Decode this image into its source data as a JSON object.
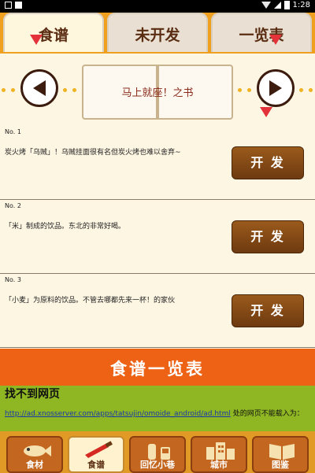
{
  "status_bar": {
    "time": "1:28"
  },
  "tabs": [
    {
      "label": "食谱",
      "active": true
    },
    {
      "label": "未开发",
      "active": false
    },
    {
      "label": "一览表",
      "active": false
    }
  ],
  "book": {
    "title": "马上就座！之书"
  },
  "recipes": [
    {
      "num": "No. 1",
      "desc": "炭火烤「乌贼」！乌贼挂面很有名但炭火烤也难以舍弃~",
      "button": "开 发"
    },
    {
      "num": "No. 2",
      "desc": "「米」制成的饮品。东北的非常好喝。",
      "button": "开 发"
    },
    {
      "num": "No. 3",
      "desc": "「小麦」为原料的饮品。不管去哪都先来一杯！的家伙",
      "button": "开 发"
    }
  ],
  "banner": {
    "label": "食谱一览表"
  },
  "ad_error": {
    "title": "找不到网页",
    "link": "http://ad.xnosserver.com/apps/tatsujin/omoide_android/ad.html",
    "suffix": " 处的网页不能载入为："
  },
  "bottom_nav": [
    {
      "label": "食材",
      "icon": "fish-icon",
      "active": false
    },
    {
      "label": "食谱",
      "icon": "knife-icon",
      "active": true
    },
    {
      "label": "回忆小巷",
      "icon": "sake-icon",
      "active": false
    },
    {
      "label": "城市",
      "icon": "city-icon",
      "active": false
    },
    {
      "label": "图鉴",
      "icon": "book-icon",
      "active": false
    }
  ],
  "colors": {
    "tab_bar": "#f0a01f",
    "button_brown": "#7a4214",
    "banner_orange": "#ee6216",
    "ad_green": "#8fb623",
    "marker_red": "#e4323a"
  }
}
